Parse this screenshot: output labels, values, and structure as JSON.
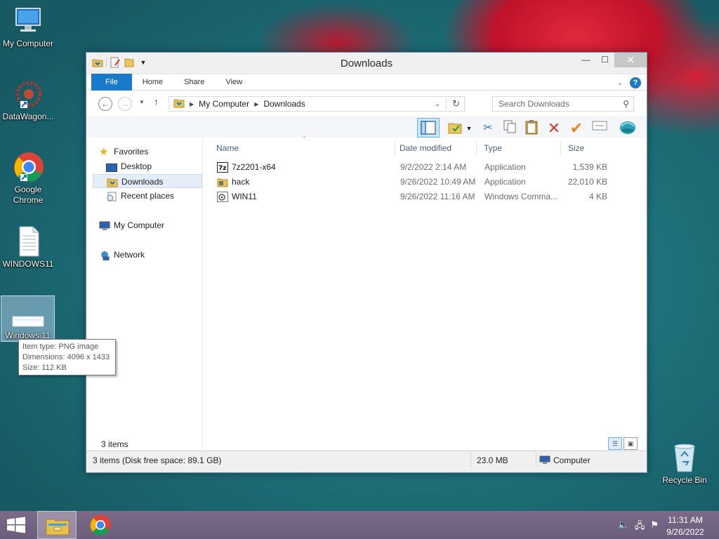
{
  "desktop": {
    "icons": [
      {
        "label": "My Computer"
      },
      {
        "label": "DataWagon..."
      },
      {
        "label": "Google Chrome"
      },
      {
        "label": "WINDOWS11"
      },
      {
        "label": "Windows 11"
      },
      {
        "label": "Recycle Bin"
      }
    ],
    "tooltip": {
      "line1": "Item type: PNG image",
      "line2": "Dimensions: 4096 x 1433",
      "line3": "Size: 112 KB"
    }
  },
  "window": {
    "title": "Downloads",
    "tabs": [
      "File",
      "Home",
      "Share",
      "View"
    ],
    "address": {
      "crumbs": [
        "My Computer",
        "Downloads"
      ]
    },
    "search_placeholder": "Search Downloads",
    "nav": {
      "favorites": "Favorites",
      "desktop": "Desktop",
      "downloads": "Downloads",
      "recent": "Recent places",
      "computer": "My Computer",
      "network": "Network"
    },
    "columns": [
      "Name",
      "Date modified",
      "Type",
      "Size"
    ],
    "files": [
      {
        "name": "7z2201-x64",
        "date": "9/2/2022 2:14 AM",
        "type": "Application",
        "size": "1,539 KB",
        "icon": "7zip-icon"
      },
      {
        "name": "hack",
        "date": "9/26/2022 10:49 AM",
        "type": "Application",
        "size": "22,010 KB",
        "icon": "app-icon"
      },
      {
        "name": "WIN11",
        "date": "9/26/2022 11:16 AM",
        "type": "Windows Comma...",
        "size": "4 KB",
        "icon": "cmd-icon"
      }
    ],
    "items_count": "3 items",
    "status": {
      "left": "3 items (Disk free space: 89.1 GB)",
      "size": "23.0 MB",
      "location": "Computer"
    }
  },
  "taskbar": {
    "time": "11:31 AM",
    "date": "9/26/2022"
  }
}
